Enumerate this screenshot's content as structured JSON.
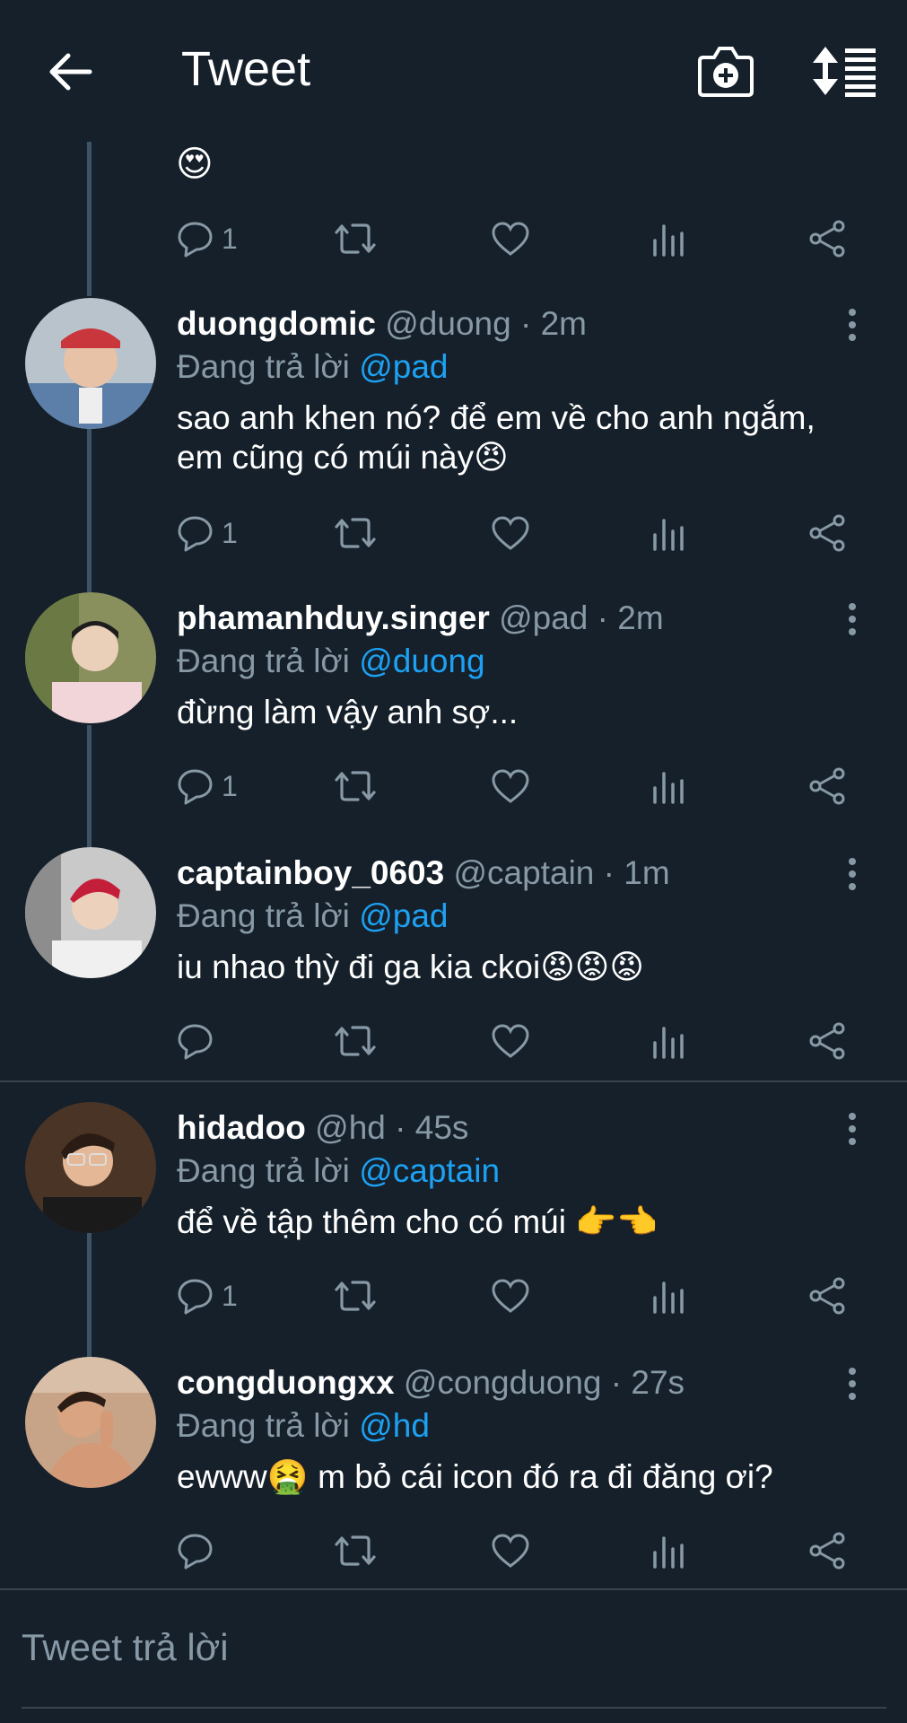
{
  "header": {
    "title": "Tweet"
  },
  "top_partial": {
    "emoji": "😍",
    "reply_count": "1"
  },
  "tweets": [
    {
      "name": "duongdomic",
      "handle": "@duong",
      "time": "· 2m",
      "replying_prefix": "Đang trả lời",
      "replying_to": "@pad",
      "text": "sao anh khen nó? để em về cho anh ngắm,\nem cũng có múi này😠",
      "reply_count": "1"
    },
    {
      "name": "phamanhduy.singer",
      "handle": "@pad",
      "time": "· 2m",
      "replying_prefix": "Đang trả lời",
      "replying_to": "@duong",
      "text": "đừng làm vậy anh sợ...",
      "reply_count": "1"
    },
    {
      "name": "captainboy_0603",
      "handle": "@captain",
      "time": "· 1m",
      "replying_prefix": "Đang trả lời",
      "replying_to": "@pad",
      "text": "iu nhao thỳ đi ga kia ckoi😡😡😡",
      "reply_count": ""
    },
    {
      "name": "hidadoo",
      "handle": "@hd",
      "time": "· 45s",
      "replying_prefix": "Đang trả lời",
      "replying_to": "@captain",
      "text": "để về tập thêm cho có múi 👉👈",
      "reply_count": "1"
    },
    {
      "name": "congduongxx",
      "handle": "@congduong",
      "time": "· 27s",
      "replying_prefix": "Đang trả lời",
      "replying_to": "@hd",
      "text": "ewww🤮 m bỏ cái icon đó ra đi đăng ơi?",
      "reply_count": ""
    }
  ],
  "reply_input": {
    "placeholder": "Tweet trả lời"
  },
  "colors": {
    "background": "#15202b",
    "accent": "#1da1f2",
    "secondary": "#8899a6",
    "divider": "#38444d"
  }
}
